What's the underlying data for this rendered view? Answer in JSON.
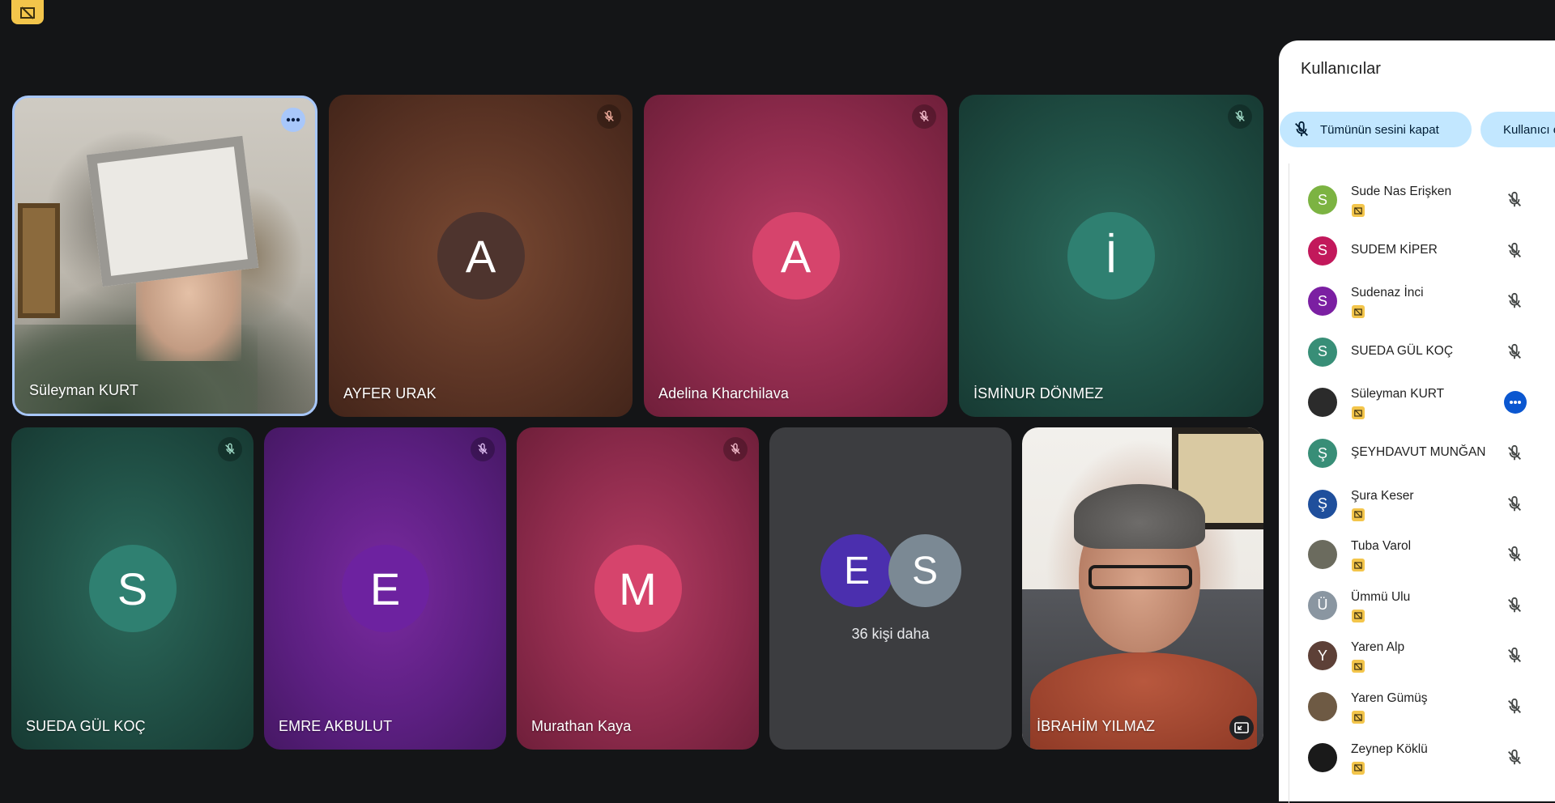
{
  "panel": {
    "title": "Kullanıcılar",
    "mute_all_label": "Tümünün sesini kapat",
    "add_people_label": "Kullanıcı ekle"
  },
  "tiles": {
    "t1": {
      "name": "Süleyman KURT"
    },
    "t2": {
      "name": "AYFER URAK",
      "initial": "A",
      "avatar_color": "#4e342e"
    },
    "t3": {
      "name": "Adelina Kharchilava",
      "initial": "A",
      "avatar_color": "#d6446c"
    },
    "t4": {
      "name": "İSMİNUR DÖNMEZ",
      "initial": "İ",
      "avatar_color": "#2f8071"
    },
    "t5": {
      "name": "SUEDA GÜL KOÇ",
      "initial": "S",
      "avatar_color": "#2f8071"
    },
    "t6": {
      "name": "EMRE AKBULUT",
      "initial": "E",
      "avatar_color": "#6d22a0"
    },
    "t7": {
      "name": "Murathan Kaya",
      "initial": "M",
      "avatar_color": "#d6446c"
    },
    "t9": {
      "name": "İBRAHİM YILMAZ"
    }
  },
  "overflow": {
    "avatars": [
      {
        "initial": "E",
        "color": "#4b2fae"
      },
      {
        "initial": "S",
        "color": "#7b8994"
      }
    ],
    "label": "36 kişi daha"
  },
  "participants": [
    {
      "name": "Sude Nas Erişken",
      "initial": "S",
      "color": "#7cb342",
      "badge": true,
      "action": "mic-off"
    },
    {
      "name": "SUDEM KİPER",
      "initial": "S",
      "color": "#c2185b",
      "badge": false,
      "action": "mic-off"
    },
    {
      "name": "Sudenaz İnci",
      "initial": "S",
      "color": "#7b1fa2",
      "badge": true,
      "action": "mic-off"
    },
    {
      "name": "SUEDA GÜL KOÇ",
      "initial": "S",
      "color": "#388e77",
      "badge": false,
      "action": "mic-off"
    },
    {
      "name": "Süleyman KURT",
      "initial": "",
      "color": "#2b2b2b",
      "badge": true,
      "action": "more"
    },
    {
      "name": "ŞEYHDAVUT MUNĞAN",
      "initial": "Ş",
      "color": "#388e77",
      "badge": false,
      "action": "mic-off"
    },
    {
      "name": "Şura Keser",
      "initial": "Ş",
      "color": "#1f4f9c",
      "badge": true,
      "action": "mic-off"
    },
    {
      "name": "Tuba Varol",
      "initial": "",
      "color": "#6b6b5e",
      "badge": true,
      "action": "mic-off"
    },
    {
      "name": "Ümmü Ulu",
      "initial": "Ü",
      "color": "#8a96a1",
      "badge": true,
      "action": "mic-off"
    },
    {
      "name": "Yaren Alp",
      "initial": "Y",
      "color": "#5d4037",
      "badge": true,
      "action": "mic-off"
    },
    {
      "name": "Yaren Gümüş",
      "initial": "",
      "color": "#6e5a44",
      "badge": true,
      "action": "mic-off"
    },
    {
      "name": "Zeynep Köklü",
      "initial": "",
      "color": "#1a1a1a",
      "badge": true,
      "action": "mic-off"
    }
  ]
}
